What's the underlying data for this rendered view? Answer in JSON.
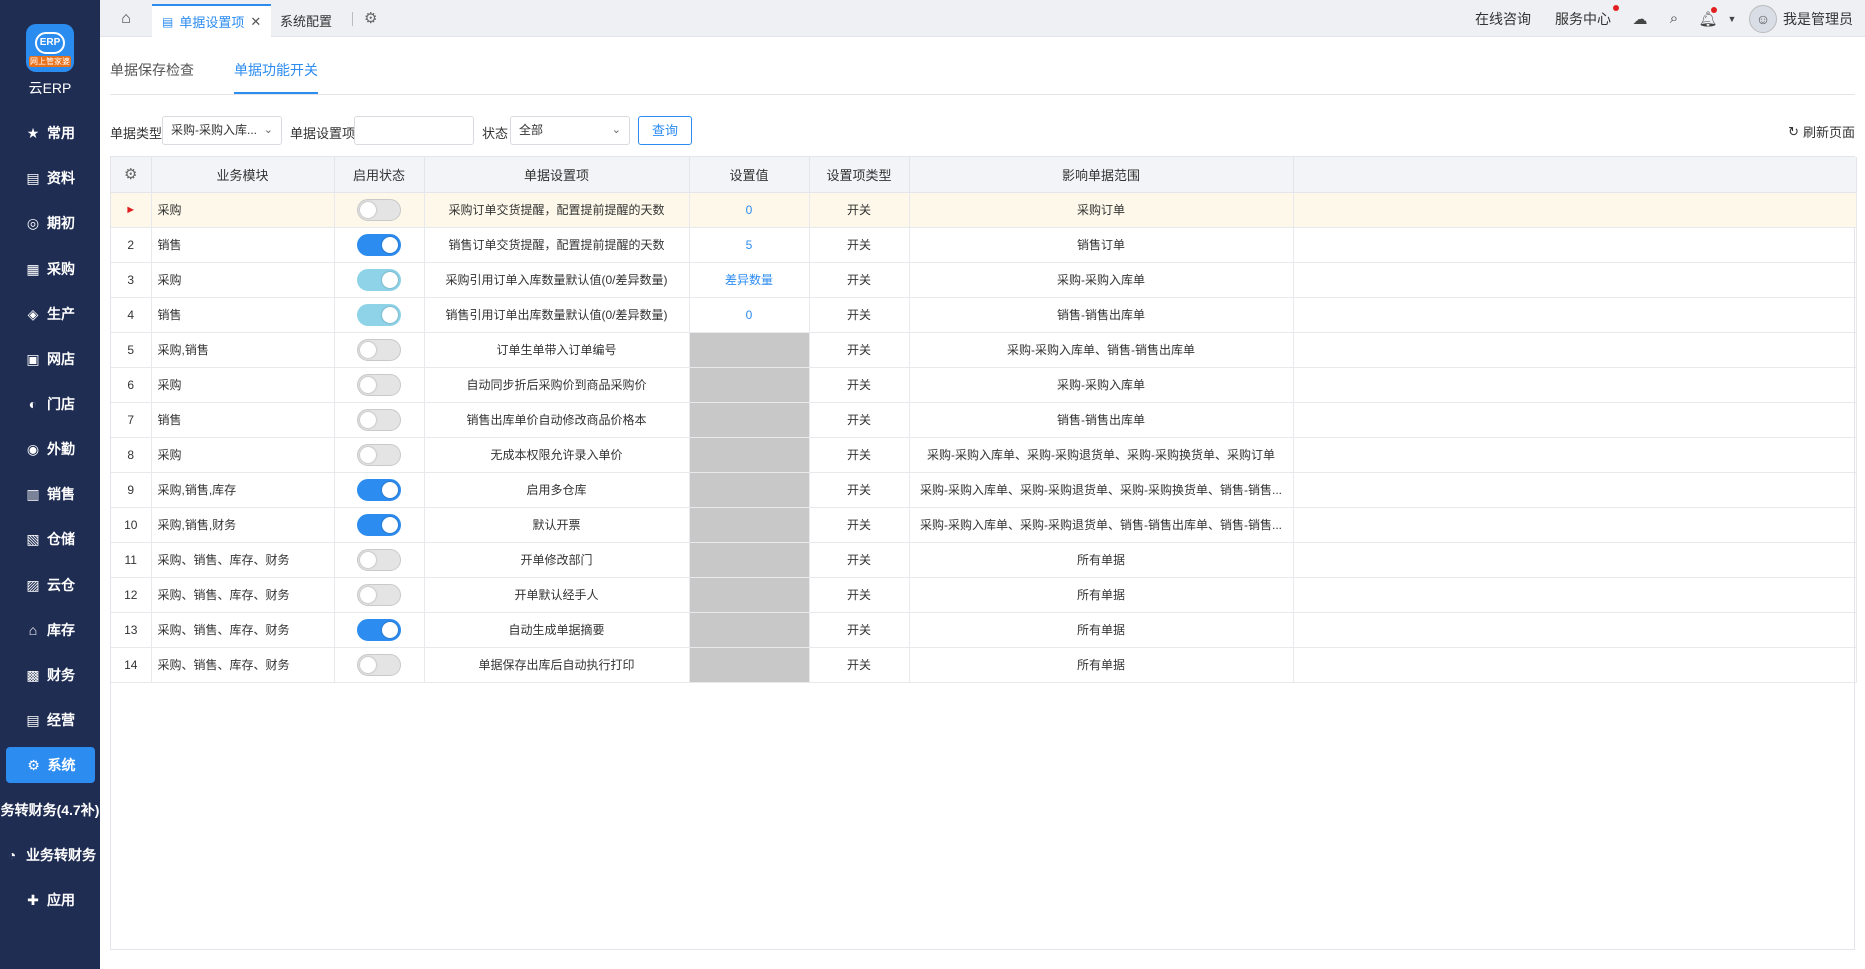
{
  "app": {
    "logo_text": "云ERP",
    "logo_strip": "网上管家婆",
    "logo_mark": "ERP"
  },
  "sidebar": {
    "items": [
      {
        "label": "常用",
        "icon": "star-icon",
        "glyph": "★"
      },
      {
        "label": "资料",
        "icon": "document-icon",
        "glyph": "▤"
      },
      {
        "label": "期初",
        "icon": "clock-icon",
        "glyph": "◎"
      },
      {
        "label": "采购",
        "icon": "cart-icon",
        "glyph": "▦"
      },
      {
        "label": "生产",
        "icon": "factory-icon",
        "glyph": "◈"
      },
      {
        "label": "网店",
        "icon": "store-icon",
        "glyph": "▣"
      },
      {
        "label": "门店",
        "icon": "shop-icon",
        "glyph": "◐"
      },
      {
        "label": "外勤",
        "icon": "location-icon",
        "glyph": "◉"
      },
      {
        "label": "销售",
        "icon": "sales-icon",
        "glyph": "▥"
      },
      {
        "label": "仓储",
        "icon": "warehouse-icon",
        "glyph": "▧"
      },
      {
        "label": "云仓",
        "icon": "cloud-warehouse-icon",
        "glyph": "▨"
      },
      {
        "label": "库存",
        "icon": "inventory-icon",
        "glyph": "⌂"
      },
      {
        "label": "财务",
        "icon": "finance-icon",
        "glyph": "▩"
      },
      {
        "label": "经营",
        "icon": "business-icon",
        "glyph": "▤"
      },
      {
        "label": "系统",
        "icon": "system-gear-icon",
        "glyph": "⚙"
      },
      {
        "label": "务转财务(4.7补)",
        "icon": "",
        "glyph": ""
      },
      {
        "label": "业务转财务",
        "icon": "transfer-icon",
        "glyph": "◔"
      },
      {
        "label": "应用",
        "icon": "app-plus-icon",
        "glyph": "✚"
      }
    ]
  },
  "topbar": {
    "tabs": [
      {
        "label": "单据设置项",
        "icon": "document-tab-icon",
        "close": "✕"
      },
      {
        "label": "系统配置"
      }
    ],
    "online_consult": "在线咨询",
    "service_center": "服务中心",
    "user_name": "我是管理员"
  },
  "subtabs": [
    "单据保存检查",
    "单据功能开关"
  ],
  "filters": {
    "type_label": "单据类型",
    "type_value": "采购-采购入库...",
    "item_label": "单据设置项",
    "item_value": "",
    "status_label": "状态",
    "status_value": "全部",
    "query_label": "查询",
    "refresh_label": "刷新页面"
  },
  "table": {
    "headers": [
      "",
      "业务模块",
      "启用状态",
      "单据设置项",
      "设置值",
      "设置项类型",
      "影响单据范围",
      ""
    ],
    "rows": [
      {
        "no": "►",
        "module": "采购",
        "toggle": "off",
        "item": "采购订单交货提醒，配置提前提醒的天数",
        "value": "0",
        "value_style": "link",
        "type": "开关",
        "scope": "采购订单",
        "selected": true
      },
      {
        "no": "2",
        "module": "销售",
        "toggle": "on",
        "item": "销售订单交货提醒，配置提前提醒的天数",
        "value": "5",
        "value_style": "link",
        "type": "开关",
        "scope": "销售订单"
      },
      {
        "no": "3",
        "module": "采购",
        "toggle": "dis",
        "item": "采购引用订单入库数量默认值(0/差异数量)",
        "value": "差异数量",
        "value_style": "link",
        "type": "开关",
        "scope": "采购-采购入库单"
      },
      {
        "no": "4",
        "module": "销售",
        "toggle": "dis",
        "item": "销售引用订单出库数量默认值(0/差异数量)",
        "value": "0",
        "value_style": "link",
        "type": "开关",
        "scope": "销售-销售出库单"
      },
      {
        "no": "5",
        "module": "采购,销售",
        "toggle": "off",
        "item": "订单生单带入订单编号",
        "value": "",
        "value_style": "gray",
        "type": "开关",
        "scope": "采购-采购入库单、销售-销售出库单"
      },
      {
        "no": "6",
        "module": "采购",
        "toggle": "off",
        "item": "自动同步折后采购价到商品采购价",
        "value": "",
        "value_style": "gray",
        "type": "开关",
        "scope": "采购-采购入库单"
      },
      {
        "no": "7",
        "module": "销售",
        "toggle": "off",
        "item": "销售出库单价自动修改商品价格本",
        "value": "",
        "value_style": "gray",
        "type": "开关",
        "scope": "销售-销售出库单"
      },
      {
        "no": "8",
        "module": "采购",
        "toggle": "off",
        "item": "无成本权限允许录入单价",
        "value": "",
        "value_style": "gray",
        "type": "开关",
        "scope": "采购-采购入库单、采购-采购退货单、采购-采购换货单、采购订单"
      },
      {
        "no": "9",
        "module": "采购,销售,库存",
        "toggle": "on",
        "item": "启用多仓库",
        "value": "",
        "value_style": "gray",
        "type": "开关",
        "scope": "采购-采购入库单、采购-采购退货单、采购-采购换货单、销售-销售..."
      },
      {
        "no": "10",
        "module": "采购,销售,财务",
        "toggle": "on",
        "item": "默认开票",
        "value": "",
        "value_style": "gray",
        "type": "开关",
        "scope": "采购-采购入库单、采购-采购退货单、销售-销售出库单、销售-销售..."
      },
      {
        "no": "11",
        "module": "采购、销售、库存、财务",
        "toggle": "off",
        "item": "开单修改部门",
        "value": "",
        "value_style": "gray",
        "type": "开关",
        "scope": "所有单据"
      },
      {
        "no": "12",
        "module": "采购、销售、库存、财务",
        "toggle": "off",
        "item": "开单默认经手人",
        "value": "",
        "value_style": "gray",
        "type": "开关",
        "scope": "所有单据"
      },
      {
        "no": "13",
        "module": "采购、销售、库存、财务",
        "toggle": "on",
        "item": "自动生成单据摘要",
        "value": "",
        "value_style": "gray",
        "type": "开关",
        "scope": "所有单据"
      },
      {
        "no": "14",
        "module": "采购、销售、库存、财务",
        "toggle": "off",
        "item": "单据保存出库后自动执行打印",
        "value": "",
        "value_style": "gray",
        "type": "开关",
        "scope": "所有单据"
      }
    ]
  }
}
